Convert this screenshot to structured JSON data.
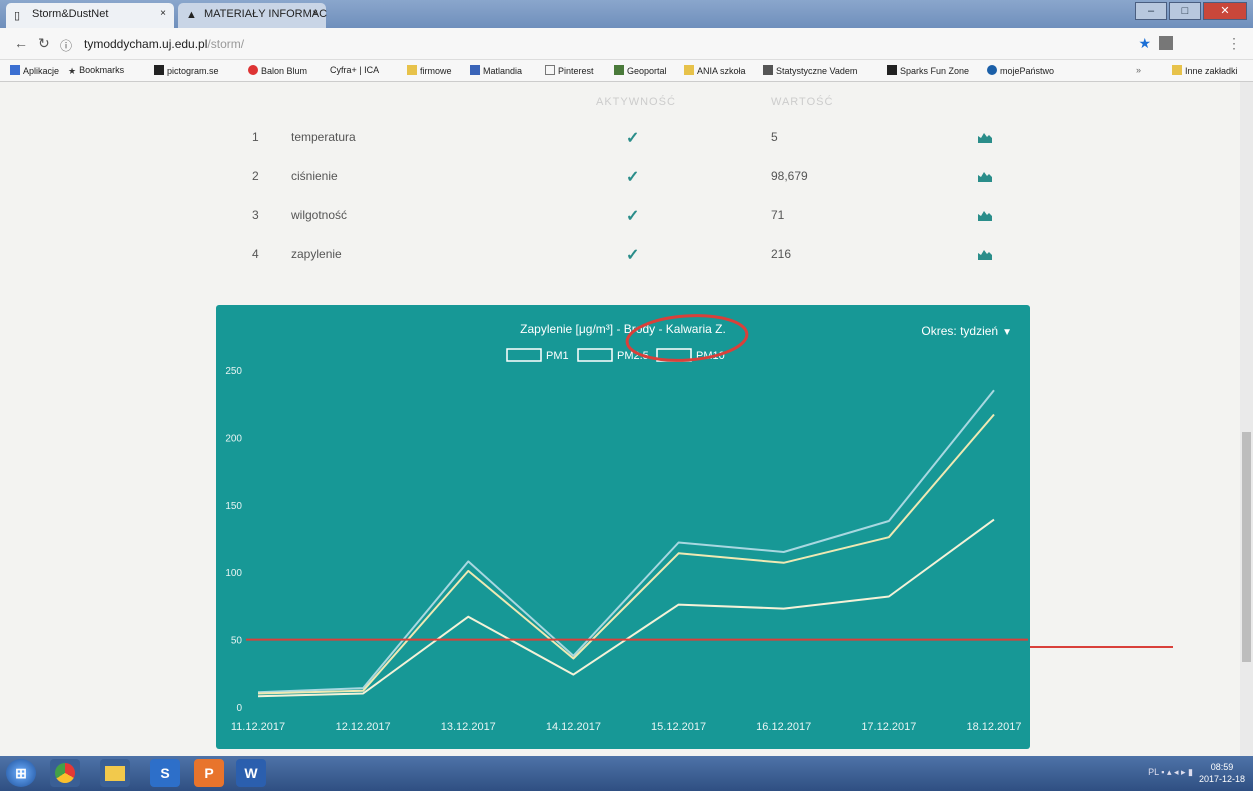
{
  "browser": {
    "tabs": [
      {
        "label": "Storm&DustNet"
      },
      {
        "label": "MATERIAŁY INFORMAC"
      }
    ],
    "url_host": "tymoddycham.uj.edu.pl",
    "url_path": "/storm/",
    "bookmarks": [
      "Aplikacje",
      "Bookmarks",
      "pictogram.se",
      "Balon Blum",
      "Cyfra+ | ICA",
      "firmowe",
      "Matlandia",
      "Pinterest",
      "Geoportal",
      "ANIA szkoła",
      "Statystyczne Vadem",
      "Sparks Fun Zone",
      "mojePaństwo"
    ],
    "bookmarks_other": "Inne zakładki"
  },
  "table": {
    "headers": {
      "activity": "AKTYWNOŚĆ",
      "value": "WARTOŚĆ"
    },
    "rows": [
      {
        "num": "1",
        "name": "temperatura",
        "value": "5"
      },
      {
        "num": "2",
        "name": "ciśnienie",
        "value": "98,679"
      },
      {
        "num": "3",
        "name": "wilgotność",
        "value": "71"
      },
      {
        "num": "4",
        "name": "zapylenie",
        "value": "216"
      }
    ]
  },
  "chart_data": {
    "type": "line",
    "title": "Zapylenie [μg/m³] - Brody - Kalwaria Z.",
    "period_label": "Okres: tydzień",
    "categories": [
      "11.12.2017",
      "12.12.2017",
      "13.12.2017",
      "14.12.2017",
      "15.12.2017",
      "16.12.2017",
      "17.12.2017",
      "18.12.2017"
    ],
    "series": [
      {
        "name": "PM1",
        "values": [
          8,
          10,
          67,
          24,
          76,
          73,
          82,
          139
        ],
        "color": "#f4f2d8"
      },
      {
        "name": "PM2.5",
        "values": [
          10,
          12,
          101,
          36,
          114,
          107,
          126,
          217
        ],
        "color": "#efe9b3"
      },
      {
        "name": "PM10",
        "values": [
          11,
          14,
          108,
          38,
          122,
          115,
          138,
          235
        ],
        "color": "#a8d8e0"
      }
    ],
    "yticks": [
      0,
      50,
      100,
      150,
      200,
      250
    ],
    "ylim": [
      0,
      250
    ],
    "reference_line": 50,
    "reference_line_color": "#d9403a",
    "background_color": "#179896",
    "grid": false,
    "legend": "top-center"
  },
  "taskbar": {
    "tray_lang": "PL",
    "clock_time": "08:59",
    "clock_date": "2017-12-18"
  }
}
